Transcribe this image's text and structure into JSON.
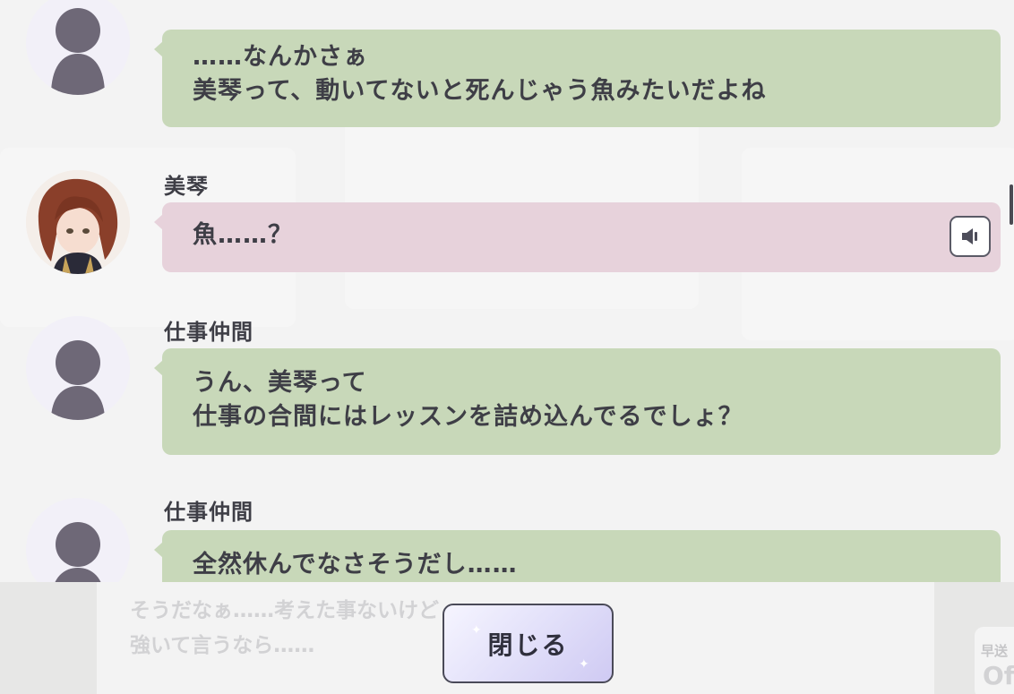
{
  "log": {
    "entries": [
      {
        "speaker": "",
        "lines": [
          "……なんかさぁ",
          "美琴って、動いてないと死んじゃう魚みたいだよね"
        ],
        "bubble_color": "#c8d8b9",
        "avatar": "silhouette-avatar",
        "has_voice": false
      },
      {
        "speaker": "美琴",
        "lines": [
          "魚……？"
        ],
        "bubble_color": "#e7d2db",
        "avatar": "character-avatar",
        "has_voice": true
      },
      {
        "speaker": "仕事仲間",
        "lines": [
          "うん、美琴って",
          "仕事の合間にはレッスンを詰め込んでるでしょ？"
        ],
        "bubble_color": "#c8d8b9",
        "avatar": "silhouette-avatar",
        "has_voice": false
      },
      {
        "speaker": "仕事仲間",
        "lines": [
          "全然休んでなさそうだし……"
        ],
        "bubble_color": "#c8d8b9",
        "avatar": "silhouette-avatar",
        "has_voice": false
      }
    ],
    "voice_icon": "speaker-icon"
  },
  "background_dialogue": {
    "lines": [
      "そうだなぁ……考えた事ないけど",
      "強いて言うなら……"
    ]
  },
  "close_button": {
    "label": "閉じる"
  },
  "fast_forward": {
    "label": "早送",
    "value": "Of"
  },
  "colors": {
    "green_bubble": "#c8d8b9",
    "pink_bubble": "#e7d2db",
    "text": "#3e3e46",
    "button_accent": "#cfcaf3"
  }
}
